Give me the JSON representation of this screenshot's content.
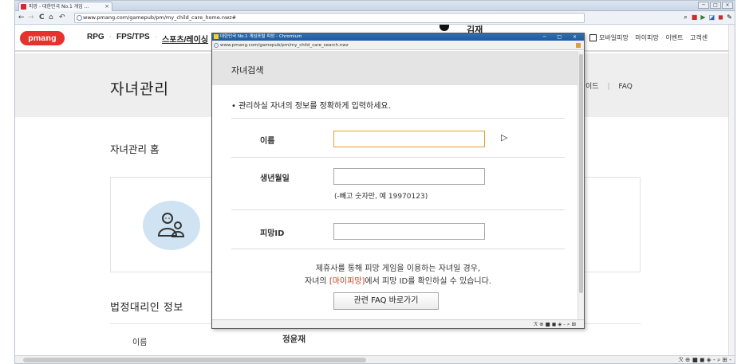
{
  "browser": {
    "tab_title": "피망 - 대한민국 No.1 게임 ...",
    "tab_close": "×",
    "url": "www.pmang.com/gamepub/pm/my_child_care_home.nwz#",
    "nav": {
      "back": "←",
      "forward": "→",
      "reload": "C",
      "home": "⌂",
      "history": "↶"
    },
    "star_area": "⊕ ☆ ◁",
    "window_controls": [
      "─",
      "□",
      "×"
    ],
    "ext_icons": [
      "⌕",
      "■",
      "▶",
      "◪",
      "◼",
      "✎"
    ]
  },
  "site": {
    "logo": "pmang",
    "gnb": [
      "RPG",
      "FPS/TPS",
      "스포츠/레이싱"
    ],
    "user_name": "김재",
    "util": [
      "모바일피망",
      "마이피망",
      "이벤트",
      "고객센"
    ]
  },
  "page": {
    "title": "자녀관리",
    "subnav": [
      "이드",
      "FAQ"
    ],
    "home_heading": "자녀관리 홈",
    "legal_heading": "법정대리인 정보",
    "legal_name_label": "이름",
    "legal_name_value": "정윤재",
    "status_icons": "ℛ ⊕ ■ ◼ ◈ - ⌕ ⊞ -"
  },
  "popup": {
    "window_title": "대한민국 No.1 게임포털 피망 - Chromium",
    "window_controls": "─ □ ×",
    "url": "www.pmang.com/gamepub/pm/my_child_care_search.nwz",
    "heading": "자녀검색",
    "description": "• 관리하실 자녀의 정보를 정확하게 입력하세요.",
    "fields": {
      "name_label": "이름",
      "name_value": "",
      "birth_label": "생년월일",
      "birth_value": "",
      "birth_hint": "(-빼고 숫자만, 예 19970123)",
      "id_label": "피망ID",
      "id_value": ""
    },
    "notice_line1": "제휴사를 통해 피망 게임을 이용하는 자녀일 경우,",
    "notice_line2_pre": "자녀의 ",
    "notice_line2_highlight": "[마이피망]",
    "notice_line2_post": "에서 피망 ID를 확인하실 수 있습니다.",
    "faq_button": "관련 FAQ 바로가기",
    "status_icons": "ℛ ⊕ ■ ◼ ◈ - ⌕ ⊞"
  },
  "colors": {
    "brand_red": "#e5322d",
    "highlight": "#c73a1b",
    "focus_border": "#e0a030",
    "avatar_bg": "#cfe3f3"
  }
}
